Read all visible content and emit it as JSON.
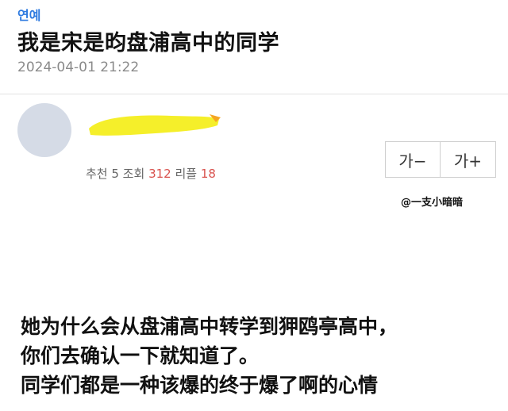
{
  "post": {
    "category": "연예",
    "title": "我是宋是昀盘浦高中的同学",
    "date": "2024-04-01 21:22"
  },
  "author": {
    "stats_prefix": "추천 5 조회 ",
    "views": "312",
    "comments_label": " 리플 ",
    "comments": "18",
    "name_redaction_color": "#f5ef2a"
  },
  "font_controls": {
    "decrease": "가−",
    "increase": "가+"
  },
  "watermark": "@一支小暗暗",
  "content": {
    "lines": [
      "她为什么会从盘浦高中转学到狎鸥亭高中，",
      "你们去确认一下就知道了。",
      "同学们都是一种该爆的终于爆了啊的心情"
    ]
  },
  "colors": {
    "category": "#2f7be0",
    "stat_highlight": "#d9534f"
  }
}
